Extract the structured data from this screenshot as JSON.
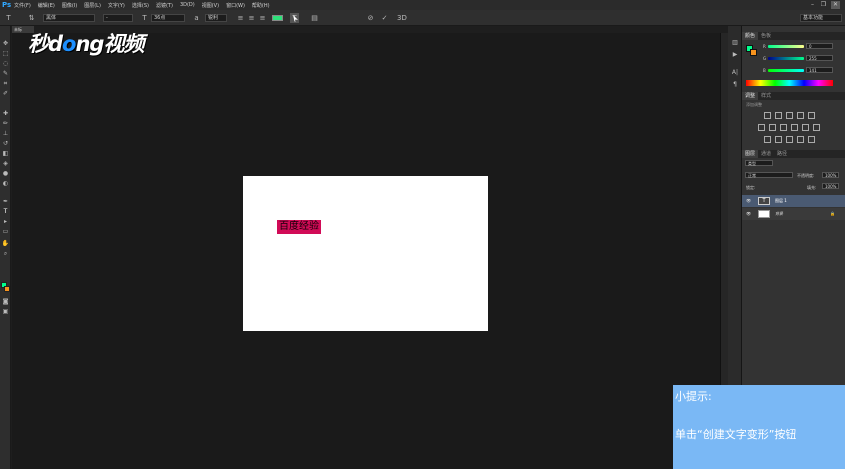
{
  "app": {
    "logo": "Ps"
  },
  "menu": [
    "文件(F)",
    "编辑(E)",
    "图像(I)",
    "图层(L)",
    "文字(Y)",
    "选择(S)",
    "滤镜(T)",
    "3D(D)",
    "视图(V)",
    "窗口(W)",
    "帮助(H)"
  ],
  "options_bar": {
    "font_family": "黑体",
    "font_style": "-",
    "font_size": "36点",
    "antialias": "锐利",
    "text_color": "#2ee07a",
    "workspace": "基本功能"
  },
  "doc_tab": "未标",
  "watermark": {
    "part1": "秒",
    "part2": "d",
    "part3": "o",
    "part4": "ng视频"
  },
  "document": {
    "text": "百度经验",
    "text_bg": "#d10b57"
  },
  "color_panel": {
    "tabs": [
      "颜色",
      "色板"
    ],
    "r_label": "R",
    "g_label": "G",
    "b_label": "B",
    "r_value": "0",
    "g_value": "255",
    "b_value": "141",
    "foreground": "#00ff8d",
    "background": "#f7931e"
  },
  "adjust_panel": {
    "tabs": [
      "调整",
      "样式"
    ],
    "subtitle": "添加调整"
  },
  "layers_panel": {
    "tabs": [
      "图层",
      "通道",
      "路径"
    ],
    "kind": "类型",
    "blend_mode": "正常",
    "opacity_label": "不透明度:",
    "opacity_value": "100%",
    "lock_label": "锁定:",
    "fill_label": "填充:",
    "fill_value": "100%",
    "layers": [
      {
        "name": "图层 1",
        "type": "T"
      },
      {
        "name": "背景",
        "type": "bg"
      }
    ]
  },
  "tip": {
    "title": "小提示:",
    "body": "单击“创建文字变形”按钮"
  }
}
